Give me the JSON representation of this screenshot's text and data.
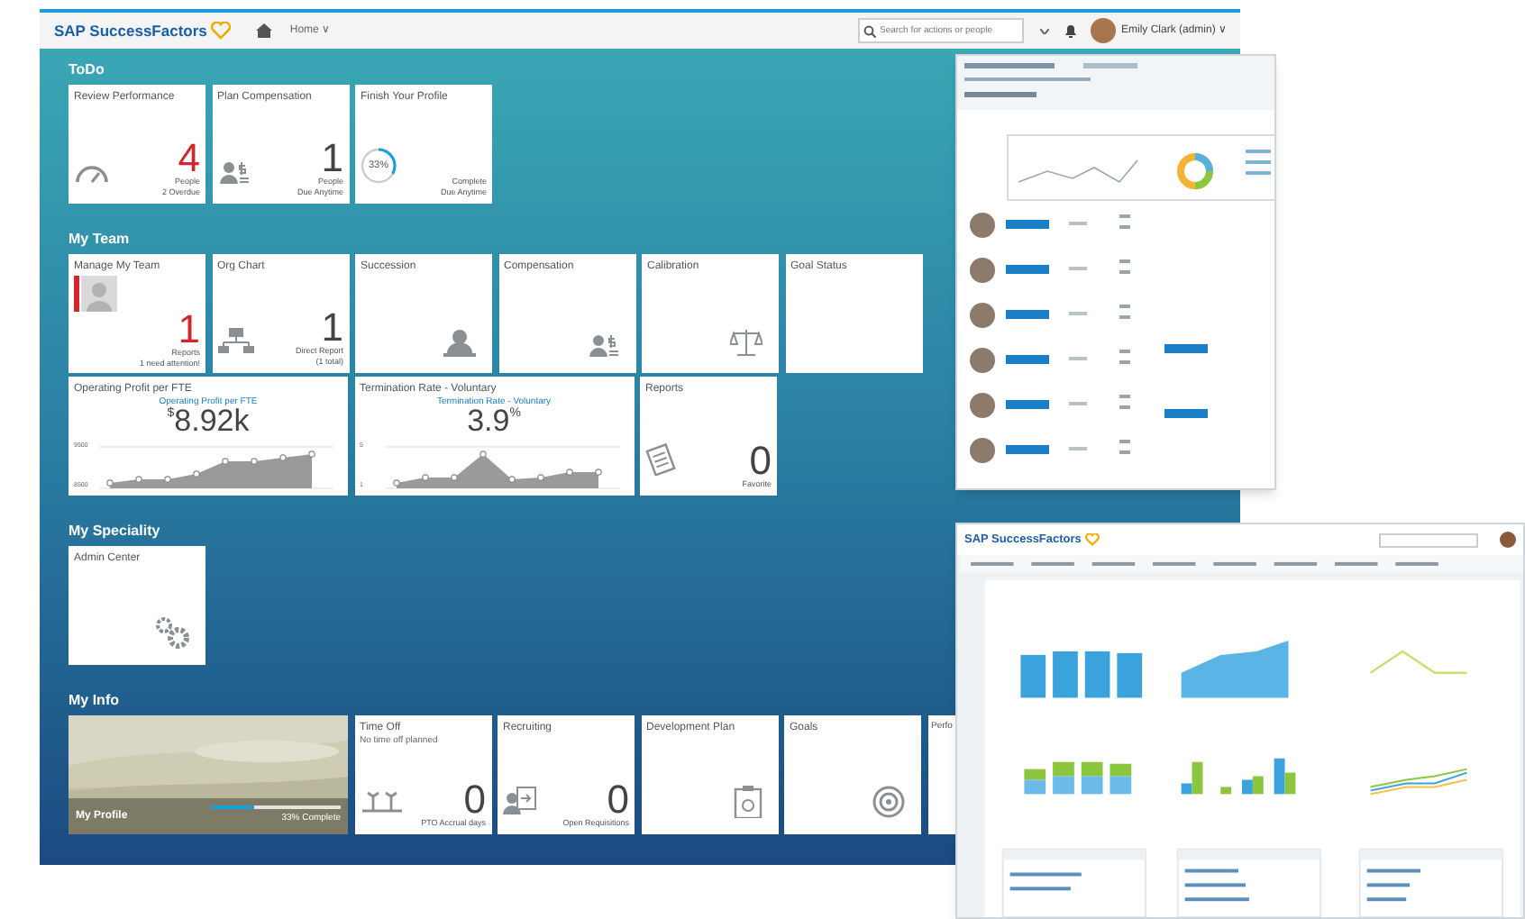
{
  "header": {
    "logo": "SAP SuccessFactors",
    "nav": "Home ∨",
    "search": {
      "placeholder": "Search for actions or people"
    },
    "user": "Emily Clark (admin) ∨"
  },
  "sections": [
    {
      "title": "ToDo",
      "rows": [
        {
          "tiles": [
            {
              "kind": "count",
              "title": "Review Performance",
              "value": "4",
              "alert": true,
              "lines": [
                "People",
                "2 Overdue"
              ]
            },
            {
              "kind": "count",
              "title": "Plan Compensation",
              "value": "1",
              "alert": false,
              "lines": [
                "People",
                "Due Anytime"
              ]
            },
            {
              "kind": "ring",
              "title": "Finish Your Profile",
              "value": "33%",
              "level": 0.33,
              "lines": [
                "Complete",
                "Due Anytime"
              ]
            }
          ]
        }
      ]
    },
    {
      "title": "My Team",
      "rows": [
        {
          "tiles": [
            {
              "kind": "count",
              "title": "Manage My Team",
              "value": "1",
              "alert": true,
              "lines": [
                "Reports",
                "1 need attention!"
              ]
            },
            {
              "kind": "count",
              "title": "Org Chart",
              "value": "1",
              "alert": false,
              "lines": [
                "Direct Report",
                "(1 total)"
              ]
            },
            {
              "kind": "icon",
              "title": "Succession"
            },
            {
              "kind": "icon",
              "title": "Compensation"
            },
            {
              "kind": "icon",
              "title": "Calibration"
            },
            {
              "kind": "icon",
              "title": "Goal Status"
            }
          ]
        },
        {
          "tiles": [
            {
              "kind": "chart",
              "title": "Operating Profit per FTE",
              "subtitle": "Operating Profit per FTE",
              "prefix": "$",
              "value": "8.92k",
              "axis": [
                "9500",
                "8500"
              ]
            },
            {
              "kind": "chart",
              "title": "Termination Rate - Voluntary",
              "subtitle": "Termination Rate - Voluntary",
              "value": "3.9",
              "suffix": "%",
              "axis": [
                "5",
                "1"
              ]
            },
            {
              "kind": "count",
              "title": "Reports",
              "value": "0",
              "alert": false,
              "lines": [
                "Favorite"
              ]
            }
          ]
        }
      ]
    },
    {
      "title": "My Speciality",
      "rows": [
        {
          "tiles": [
            {
              "kind": "icon",
              "title": "Admin Center"
            }
          ]
        }
      ]
    },
    {
      "title": "My Info",
      "rows": [
        {
          "tiles": [
            {
              "kind": "profile",
              "title": "My Profile",
              "level": 0.33,
              "reading": "33% Complete"
            },
            {
              "kind": "count",
              "title": "Time Off",
              "subtitle": "No time off planned",
              "value": "0",
              "alert": false,
              "lines": [
                "PTO Accrual days"
              ]
            },
            {
              "kind": "count",
              "title": "Recruiting",
              "value": "0",
              "alert": false,
              "lines": [
                "Open Requisitions"
              ]
            },
            {
              "kind": "icon",
              "title": "Development Plan"
            },
            {
              "kind": "icon",
              "title": "Goals"
            },
            {
              "kind": "clipped",
              "title": "Perfo"
            }
          ]
        }
      ]
    }
  ],
  "second_window": {
    "logo": "SAP SuccessFactors"
  }
}
